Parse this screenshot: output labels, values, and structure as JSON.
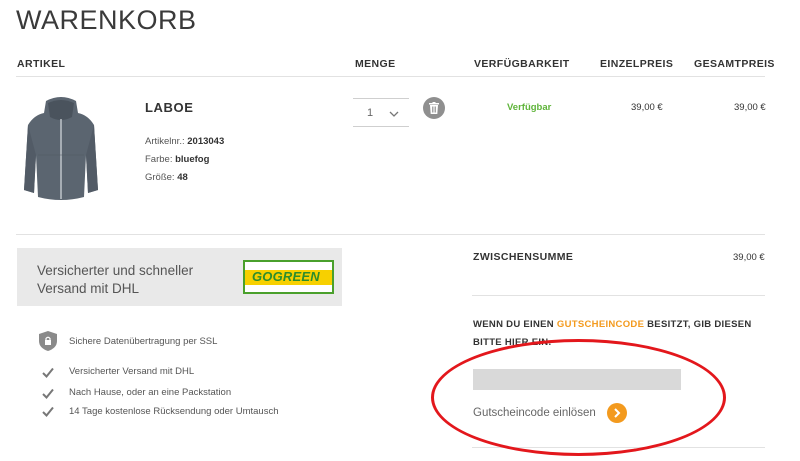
{
  "page": {
    "title": "WARENKORB"
  },
  "table_headers": {
    "artikel": "ARTIKEL",
    "menge": "MENGE",
    "verfuegbarkeit": "VERFÜGBARKEIT",
    "einzelpreis": "EINZELPREIS",
    "gesamtpreis": "GESAMTPREIS"
  },
  "cart_item": {
    "name": "LABOE",
    "article_label": "Artikelnr.:",
    "article_no": "2013043",
    "color_label": "Farbe:",
    "color": "bluefog",
    "size_label": "Größe:",
    "size": "48",
    "quantity": "1",
    "availability": "Verfügbar",
    "unit_price": "39,00 €",
    "total_price": "39,00 €"
  },
  "shipping": {
    "banner_text": "Versicherter und schneller Versand mit DHL",
    "logo_text": "GOGREEN"
  },
  "features": [
    {
      "icon": "lock-shield-icon",
      "text": "Sichere Datenübertragung per SSL"
    },
    {
      "icon": "check-icon",
      "text": "Versicherter Versand mit DHL"
    },
    {
      "icon": "check-icon",
      "text": "Nach Hause, oder an eine Packstation"
    },
    {
      "icon": "check-icon",
      "text": "14 Tage kostenlose Rücksendung oder Umtausch"
    }
  ],
  "totals": {
    "subtotal_label": "ZWISCHENSUMME",
    "subtotal_value": "39,00 €"
  },
  "coupon": {
    "text_before": "WENN DU EINEN ",
    "highlight": "GUTSCHEINCODE",
    "text_after": " BESITZT, GIB DIESEN BITTE HIER EIN.",
    "input_value": "",
    "redeem_label": "Gutscheincode einlösen"
  },
  "colors": {
    "accent": "#f39a1e",
    "available": "#5fb43a",
    "annotation": "#e3171c",
    "dhl_green": "#2c8d2c",
    "dhl_yellow": "#f7d000"
  }
}
